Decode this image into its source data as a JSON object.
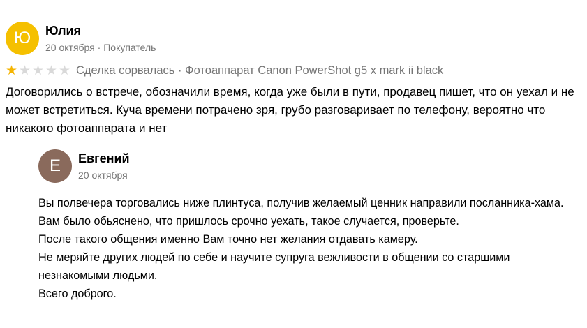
{
  "review": {
    "author": {
      "initial": "Ю",
      "name": "Юлия",
      "date": "20 октября",
      "role": "Покупатель",
      "avatar_color": "#f5c000"
    },
    "rating": {
      "value": 1,
      "max": 5
    },
    "deal_status": "Сделка сорвалась",
    "product": "Фотоаппарат Canon PowerShot g5 x mark ii black",
    "text": "Договорились о встрече, обозначили время, когда уже были в пути, продавец пишет, что он уехал и не может встретиться. Куча времени потрачено зря, грубо разговаривает по телефону, вероятно что никакого фотоаппарата и нет"
  },
  "reply": {
    "author": {
      "initial": "Е",
      "name": "Евгений",
      "date": "20 октября",
      "avatar_color": "#8a6a5c"
    },
    "lines": [
      "Вы полвечера торговались ниже плинтуса, получив желаемый ценник направили посланника-хама.",
      "Вам было обьяснено, что пришлось срочно уехать, такое случается, проверьте.",
      "После такого общения именно Вам точно нет желания отдавать камеру.",
      "Не меряйте других людей по себе и научите супруга вежливости в общении со старшими незнакомыми людьми.",
      "Всего доброго."
    ]
  },
  "colors": {
    "star_filled": "#f5b400",
    "star_empty": "#d9d9d9",
    "secondary_text": "#757575"
  },
  "separator": "·"
}
